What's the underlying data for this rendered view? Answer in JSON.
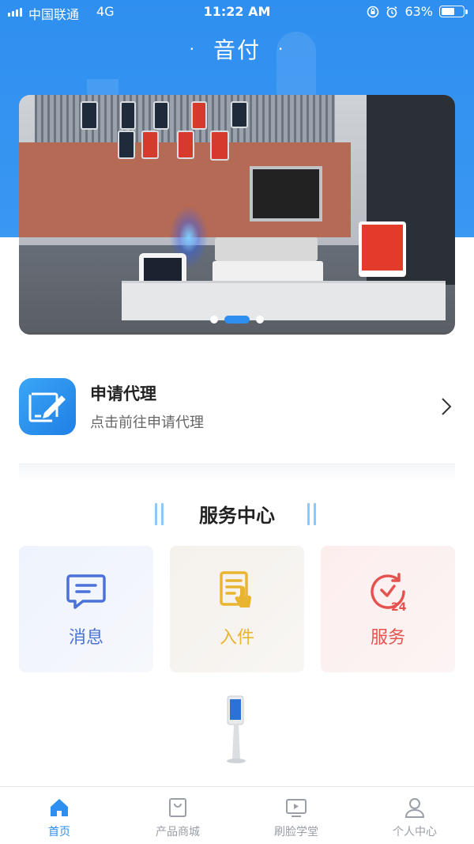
{
  "status_bar": {
    "carrier": "中国联通",
    "network": "4G",
    "time": "11:22 AM",
    "battery": "63%",
    "battery_level": 0.63
  },
  "header": {
    "title": "音付",
    "dot_left": "·",
    "dot_right": "·"
  },
  "banner": {
    "slides": 3,
    "active_slide": 2
  },
  "apply_agent": {
    "title": "申请代理",
    "subtitle": "点击前往申请代理"
  },
  "service_center": {
    "title": "服务中心",
    "items": [
      {
        "label": "消息",
        "icon": "message-icon",
        "color": "#4a72d8"
      },
      {
        "label": "入件",
        "icon": "document-touch-icon",
        "color": "#e9b531"
      },
      {
        "label": "服务",
        "icon": "clock-24-icon",
        "color": "#e5534f"
      }
    ]
  },
  "tabs": [
    {
      "label": "首页",
      "icon": "home-icon",
      "active": true
    },
    {
      "label": "产品商城",
      "icon": "shop-bag-icon",
      "active": false
    },
    {
      "label": "刷脸学堂",
      "icon": "video-play-icon",
      "active": false
    },
    {
      "label": "个人中心",
      "icon": "user-icon",
      "active": false
    }
  ],
  "colors": {
    "primary": "#2f8ff0",
    "tab_inactive": "#9a9ea6"
  }
}
